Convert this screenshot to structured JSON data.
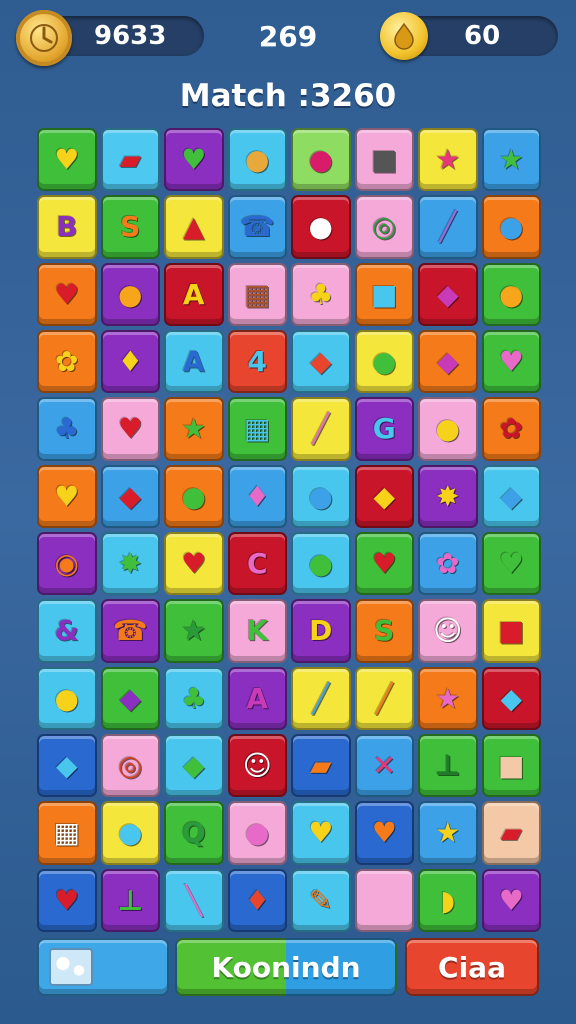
{
  "hud": {
    "coins": "9633",
    "moves": "269",
    "gems": "60",
    "coin_icon": "coin-clock-icon",
    "gem_icon": "gem-drop-icon"
  },
  "score_text": "Match :3260",
  "board": {
    "rows": [
      [
        {
          "c": "#3fbf3a",
          "g": "♥",
          "f": "#f7d21a"
        },
        {
          "c": "#4dc8f0",
          "g": "▰",
          "f": "#d81c2a"
        },
        {
          "c": "#8a2fbf",
          "g": "♥",
          "f": "#3fbf3a"
        },
        {
          "c": "#49c6ee",
          "g": "●",
          "f": "#e8a93a"
        },
        {
          "c": "#8fdc62",
          "g": "●",
          "f": "#d81c6a"
        },
        {
          "c": "#f4a9d8",
          "g": "■",
          "f": "#555555"
        },
        {
          "c": "#f4e63a",
          "g": "★",
          "f": "#e8367a"
        },
        {
          "c": "#3da1e8",
          "g": "★",
          "f": "#3fbf3a"
        }
      ],
      [
        {
          "c": "#f4e63a",
          "g": "B",
          "f": "#8a2fbf"
        },
        {
          "c": "#3fbf3a",
          "g": "S",
          "f": "#f47a1a"
        },
        {
          "c": "#f4e63a",
          "g": "▲",
          "f": "#d81c2a"
        },
        {
          "c": "#3da1e8",
          "g": "☎",
          "f": "#2a6ad0"
        },
        {
          "c": "#c8152a",
          "g": "●",
          "f": "#ffffff"
        },
        {
          "c": "#f4a9d8",
          "g": "◎",
          "f": "#2a9a3a"
        },
        {
          "c": "#3da1e8",
          "g": "╱",
          "f": "#9a6ae0"
        },
        {
          "c": "#f47a1a",
          "g": "●",
          "f": "#3da1e8"
        }
      ],
      [
        {
          "c": "#f47a1a",
          "g": "♥",
          "f": "#d81c2a"
        },
        {
          "c": "#8a2fbf",
          "g": "●",
          "f": "#f7a51a"
        },
        {
          "c": "#c8152a",
          "g": "A",
          "f": "#f7d21a"
        },
        {
          "c": "#f4a9d8",
          "g": "▦",
          "f": "#b0552a"
        },
        {
          "c": "#f4a9d8",
          "g": "♣",
          "f": "#f7d21a"
        },
        {
          "c": "#f47a1a",
          "g": "■",
          "f": "#49c6ee"
        },
        {
          "c": "#c8152a",
          "g": "◆",
          "f": "#c83ab8"
        },
        {
          "c": "#3fbf3a",
          "g": "●",
          "f": "#f7a51a"
        }
      ],
      [
        {
          "c": "#f47a1a",
          "g": "✿",
          "f": "#f7d21a"
        },
        {
          "c": "#8a2fbf",
          "g": "♦",
          "f": "#f7d21a"
        },
        {
          "c": "#49c6ee",
          "g": "A",
          "f": "#2a6ad0"
        },
        {
          "c": "#e8452e",
          "g": "4",
          "f": "#49c6ee"
        },
        {
          "c": "#49c6ee",
          "g": "◆",
          "f": "#e8452e"
        },
        {
          "c": "#f4e63a",
          "g": "●",
          "f": "#3fbf3a"
        },
        {
          "c": "#f47a1a",
          "g": "◆",
          "f": "#c83ab8"
        },
        {
          "c": "#3fbf3a",
          "g": "♥",
          "f": "#e86ac8"
        }
      ],
      [
        {
          "c": "#3da1e8",
          "g": "♣",
          "f": "#2a6ad0"
        },
        {
          "c": "#f4a9d8",
          "g": "♥",
          "f": "#d81c2a"
        },
        {
          "c": "#f47a1a",
          "g": "★",
          "f": "#3fbf3a"
        },
        {
          "c": "#3fbf3a",
          "g": "▦",
          "f": "#49c6ee"
        },
        {
          "c": "#f4e63a",
          "g": "╱",
          "f": "#e86ac8"
        },
        {
          "c": "#8a2fbf",
          "g": "G",
          "f": "#49c6ee"
        },
        {
          "c": "#f4a9d8",
          "g": "●",
          "f": "#f7d21a"
        },
        {
          "c": "#f47a1a",
          "g": "✿",
          "f": "#c8152a"
        }
      ],
      [
        {
          "c": "#f47a1a",
          "g": "♥",
          "f": "#f7d21a"
        },
        {
          "c": "#3da1e8",
          "g": "◆",
          "f": "#d81c2a"
        },
        {
          "c": "#f47a1a",
          "g": "●",
          "f": "#3fbf3a"
        },
        {
          "c": "#3da1e8",
          "g": "♦",
          "f": "#e86ac8"
        },
        {
          "c": "#49c6ee",
          "g": "●",
          "f": "#3da1e8"
        },
        {
          "c": "#c8152a",
          "g": "◆",
          "f": "#f7d21a"
        },
        {
          "c": "#8a2fbf",
          "g": "✸",
          "f": "#f7d21a"
        },
        {
          "c": "#49c6ee",
          "g": "◆",
          "f": "#3da1e8"
        }
      ],
      [
        {
          "c": "#8a2fbf",
          "g": "◉",
          "f": "#f47a1a"
        },
        {
          "c": "#49c6ee",
          "g": "✸",
          "f": "#3fbf3a"
        },
        {
          "c": "#f4e63a",
          "g": "♥",
          "f": "#d81c2a"
        },
        {
          "c": "#c8152a",
          "g": "C",
          "f": "#e86ac8"
        },
        {
          "c": "#49c6ee",
          "g": "●",
          "f": "#3fbf3a"
        },
        {
          "c": "#3fbf3a",
          "g": "♥",
          "f": "#d81c2a"
        },
        {
          "c": "#3da1e8",
          "g": "✿",
          "f": "#e86ac8"
        },
        {
          "c": "#3fbf3a",
          "g": "♥",
          "f": "#3fbf3a"
        }
      ],
      [
        {
          "c": "#49c6ee",
          "g": "&",
          "f": "#8a2fbf"
        },
        {
          "c": "#8a2fbf",
          "g": "☎",
          "f": "#f47a1a"
        },
        {
          "c": "#3fbf3a",
          "g": "★",
          "f": "#2a9a3a"
        },
        {
          "c": "#f4a9d8",
          "g": "K",
          "f": "#3fbf3a"
        },
        {
          "c": "#8a2fbf",
          "g": "D",
          "f": "#f7d21a"
        },
        {
          "c": "#f47a1a",
          "g": "S",
          "f": "#3fbf3a"
        },
        {
          "c": "#f4a9d8",
          "g": "☺",
          "f": "#ffffff"
        },
        {
          "c": "#f4e63a",
          "g": "■",
          "f": "#d81c2a"
        }
      ],
      [
        {
          "c": "#49c6ee",
          "g": "●",
          "f": "#f7d21a"
        },
        {
          "c": "#3fbf3a",
          "g": "◆",
          "f": "#8a2fbf"
        },
        {
          "c": "#49c6ee",
          "g": "♣",
          "f": "#3fbf3a"
        },
        {
          "c": "#8a2fbf",
          "g": "A",
          "f": "#c83ab8"
        },
        {
          "c": "#f4e63a",
          "g": "╱",
          "f": "#3da1e8"
        },
        {
          "c": "#f4e63a",
          "g": "╱",
          "f": "#f47a1a"
        },
        {
          "c": "#f47a1a",
          "g": "★",
          "f": "#e86ac8"
        },
        {
          "c": "#c8152a",
          "g": "◆",
          "f": "#49c6ee"
        }
      ],
      [
        {
          "c": "#2a6ad0",
          "g": "◆",
          "f": "#49c6ee"
        },
        {
          "c": "#f4a9d8",
          "g": "◎",
          "f": "#d8421a"
        },
        {
          "c": "#49c6ee",
          "g": "◆",
          "f": "#3fbf3a"
        },
        {
          "c": "#c8152a",
          "g": "☺",
          "f": "#ffffff"
        },
        {
          "c": "#2a6ad0",
          "g": "▰",
          "f": "#f47a1a"
        },
        {
          "c": "#3da1e8",
          "g": "✕",
          "f": "#e8367a"
        },
        {
          "c": "#3fbf3a",
          "g": "⊥",
          "f": "#1f7a2a"
        },
        {
          "c": "#3fbf3a",
          "g": "■",
          "f": "#f4c9a8"
        }
      ],
      [
        {
          "c": "#f47a1a",
          "g": "▦",
          "f": "#ffffff"
        },
        {
          "c": "#f4e63a",
          "g": "●",
          "f": "#49c6ee"
        },
        {
          "c": "#3fbf3a",
          "g": "Q",
          "f": "#2a9a3a"
        },
        {
          "c": "#f4a9d8",
          "g": "●",
          "f": "#e86ac8"
        },
        {
          "c": "#49c6ee",
          "g": "♥",
          "f": "#f7d21a"
        },
        {
          "c": "#2a6ad0",
          "g": "♥",
          "f": "#f47a1a"
        },
        {
          "c": "#3da1e8",
          "g": "★",
          "f": "#f7d21a"
        },
        {
          "c": "#f4c9a8",
          "g": "▰",
          "f": "#d81c2a"
        }
      ],
      [
        {
          "c": "#2a6ad0",
          "g": "♥",
          "f": "#d81c2a"
        },
        {
          "c": "#8a2fbf",
          "g": "⊥",
          "f": "#3fbf3a"
        },
        {
          "c": "#49c6ee",
          "g": "╲",
          "f": "#e86ac8"
        },
        {
          "c": "#2a6ad0",
          "g": "♦",
          "f": "#e8452e"
        },
        {
          "c": "#49c6ee",
          "g": "✎",
          "f": "#f47a1a"
        },
        {
          "c": "#f4a9d8",
          "g": "",
          "f": "#f4a9d8"
        },
        {
          "c": "#3fbf3a",
          "g": "◗",
          "f": "#f7d21a"
        },
        {
          "c": "#8a2fbf",
          "g": "♥",
          "f": "#e86ac8"
        }
      ]
    ]
  },
  "buttons": {
    "left_icon": "puzzle-icon",
    "mid_label": "Koonindn",
    "right_label": "Ciaa"
  }
}
